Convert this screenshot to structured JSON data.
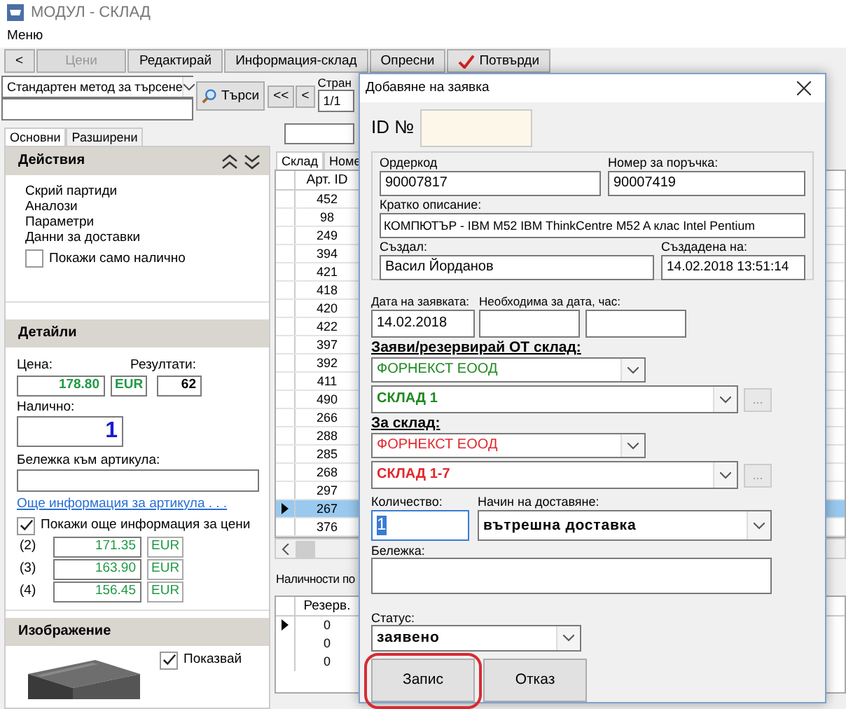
{
  "window": {
    "title": "МОДУЛ - СКЛАД"
  },
  "menu": [
    "Меню"
  ],
  "toolbar": [
    {
      "label": "<",
      "disabled": false,
      "kind": "plain"
    },
    {
      "label": "Цени",
      "disabled": true,
      "kind": "plain"
    },
    {
      "label": "Редактирай",
      "disabled": false,
      "kind": "plain"
    },
    {
      "label": "Информация-склад",
      "disabled": false,
      "kind": "plain"
    },
    {
      "label": "Опресни",
      "disabled": false,
      "kind": "plain"
    },
    {
      "label": "Потвърди",
      "disabled": false,
      "kind": "confirm"
    }
  ],
  "search": {
    "method": "Стандартен метод за търсене",
    "button": "Търси",
    "nav": [
      "<<",
      "<"
    ],
    "page_label": "Стран",
    "page": "1/1"
  },
  "left_tabs": [
    {
      "label": "Основни",
      "selected": true
    },
    {
      "label": "Разширени",
      "selected": false
    }
  ],
  "actions": {
    "title": "Действия",
    "items": [
      "Скрий партиди",
      "Аналози",
      "Параметри",
      "Данни за доставки"
    ],
    "only_available": {
      "label": "Покажи само налично",
      "checked": false
    }
  },
  "details": {
    "title": "Детайли",
    "price_label": "Цена:",
    "price": "178.80",
    "currency": "EUR",
    "results_label": "Резултати:",
    "results": "62",
    "available_label": "Налично:",
    "available": "1",
    "note_label": "Бележка към артикула:",
    "more_link": "Още информация за артикула . . .",
    "more_prices": {
      "label": "Покажи още информация за цени",
      "checked": true
    },
    "prices": [
      {
        "tier": "(2)",
        "value": "171.35",
        "currency": "EUR"
      },
      {
        "tier": "(3)",
        "value": "163.90",
        "currency": "EUR"
      },
      {
        "tier": "(4)",
        "value": "156.45",
        "currency": "EUR"
      }
    ]
  },
  "image": {
    "title": "Изображение",
    "show": {
      "label": "Показвай",
      "checked": true
    }
  },
  "grid_tabs": [
    {
      "label": "Склад",
      "selected": true
    },
    {
      "label": "Номе",
      "selected": false
    }
  ],
  "stock_table": {
    "columns": [
      "Арт. ID"
    ],
    "rows": [
      {
        "cells": [
          "452"
        ],
        "selected": false
      },
      {
        "cells": [
          "98"
        ],
        "selected": false
      },
      {
        "cells": [
          "249"
        ],
        "selected": false
      },
      {
        "cells": [
          "394"
        ],
        "selected": false
      },
      {
        "cells": [
          "421"
        ],
        "selected": false
      },
      {
        "cells": [
          "418"
        ],
        "selected": false
      },
      {
        "cells": [
          "420"
        ],
        "selected": false
      },
      {
        "cells": [
          "422"
        ],
        "selected": false
      },
      {
        "cells": [
          "397"
        ],
        "selected": false
      },
      {
        "cells": [
          "392"
        ],
        "selected": false
      },
      {
        "cells": [
          "411"
        ],
        "selected": false
      },
      {
        "cells": [
          "490"
        ],
        "selected": false
      },
      {
        "cells": [
          "266"
        ],
        "selected": false
      },
      {
        "cells": [
          "288"
        ],
        "selected": false
      },
      {
        "cells": [
          "285"
        ],
        "selected": false
      },
      {
        "cells": [
          "268"
        ],
        "selected": false
      },
      {
        "cells": [
          "297"
        ],
        "selected": false
      },
      {
        "cells": [
          "267"
        ],
        "selected": true
      },
      {
        "cells": [
          "376"
        ],
        "selected": false
      }
    ]
  },
  "availability": {
    "title": "Наличности по",
    "columns": [
      "Резерв."
    ],
    "rows": [
      {
        "cells": [
          "0"
        ],
        "current": true
      },
      {
        "cells": [
          "0"
        ],
        "current": false
      },
      {
        "cells": [
          "0"
        ],
        "current": false
      }
    ]
  },
  "dialog": {
    "title": "Добавяне на заявка",
    "id_label": "ID №",
    "order_code_label": "Ордеркод",
    "order_code": "90007817",
    "order_no_label": "Номер за поръчка:",
    "order_no": "90007419",
    "desc_label": "Кратко описание:",
    "desc": "КОМПЮТЪР - IBM M52 IBM ThinkCentre M52 A клас Intel Pentium",
    "created_by_label": "Създал:",
    "created_by": "Васил Йорданов",
    "created_at_label": "Създадена на:",
    "created_at": "14.02.2018 13:51:14",
    "request_date_label": "Дата на заявката:",
    "request_date": "14.02.2018",
    "needed_label": "Необходима за дата, час:",
    "warehouses": [
      {
        "label": "Заяви/резервирай ОТ склад:",
        "company": "ФОРНЕКСТ ЕООД",
        "warehouse": "СКЛАД 1",
        "more_button": "...",
        "color": "#1e8a1e"
      },
      {
        "label": "За склад:",
        "company": "ФОРНЕКСТ ЕООД",
        "warehouse": "СКЛАД 1-7",
        "more_button": "...",
        "color": "#e3262b"
      }
    ],
    "quantity_label": "Количество:",
    "quantity": "1",
    "quantity_highlighted": true,
    "delivery_label": "Начин на доставяне:",
    "delivery": "вътрешна доставка",
    "note_label": "Бележка:",
    "status_label": "Статус:",
    "status": "заявено",
    "buttons": [
      {
        "label": "Запис",
        "circled": true
      },
      {
        "label": "Отказ",
        "circled": false
      }
    ]
  }
}
